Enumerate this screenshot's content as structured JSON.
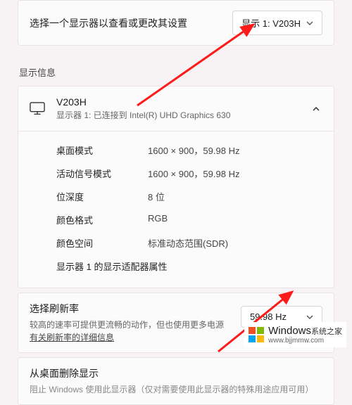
{
  "top": {
    "label": "选择一个显示器以查看或更改其设置",
    "selected": "显示 1: V203H"
  },
  "section_title": "显示信息",
  "display_card": {
    "title": "V203H",
    "subtitle": "显示器 1: 已连接到 Intel(R) UHD Graphics 630",
    "props": [
      {
        "label": "桌面模式",
        "value": "1600 × 900，59.98 Hz"
      },
      {
        "label": "活动信号模式",
        "value": "1600 × 900，59.98 Hz"
      },
      {
        "label": "位深度",
        "value": "8 位"
      },
      {
        "label": "颜色格式",
        "value": "RGB"
      },
      {
        "label": "颜色空间",
        "value": "标准动态范围(SDR)"
      }
    ],
    "adapter_link": "显示器 1 的显示适配器属性"
  },
  "refresh": {
    "title": "选择刷新率",
    "desc_prefix": "较高的速率可提供更流畅的动作，但也使用更多电源 ",
    "desc_link": "有关刷新率的详细信息",
    "selected": "59.98 Hz"
  },
  "remove": {
    "title": "从桌面删除显示",
    "desc": "阻止 Windows 使用此显示器（仅对需要使用此显示器的特殊用途应用可用）"
  },
  "watermark": {
    "brand": "Windows",
    "tagline": "系统之家",
    "url": "www.bjjmmw.com"
  }
}
